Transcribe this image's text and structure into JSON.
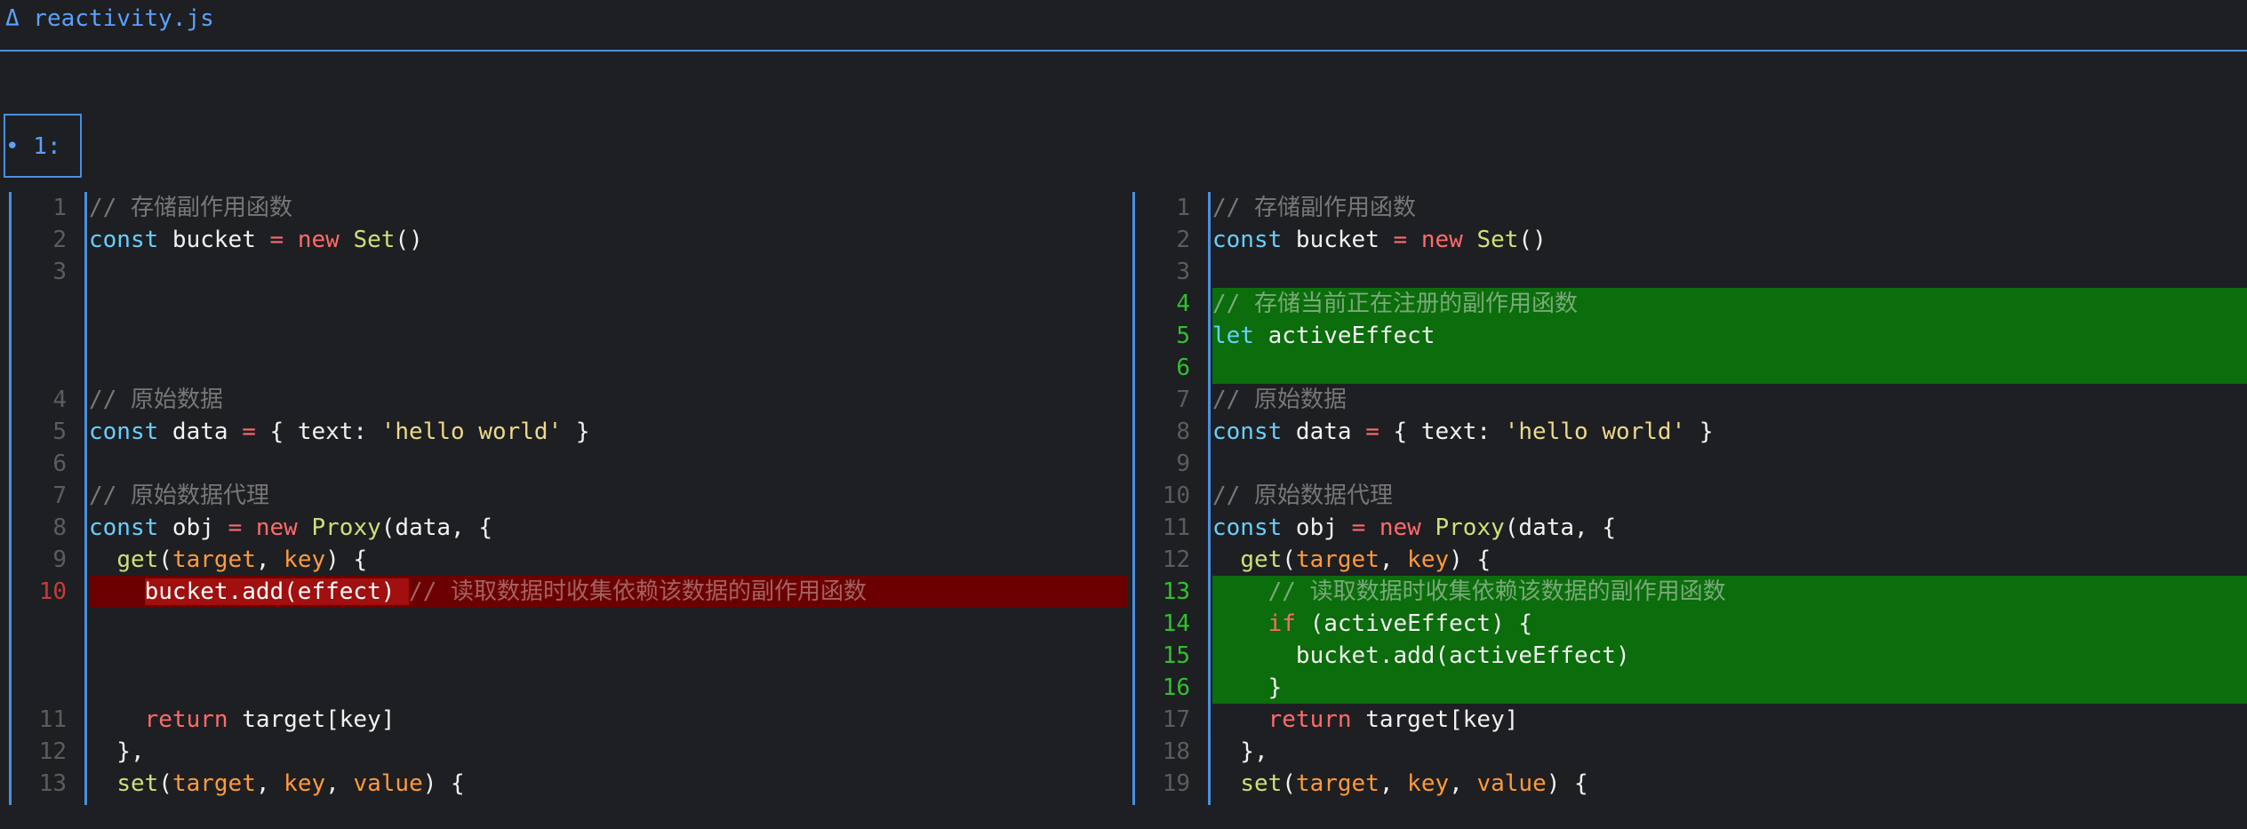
{
  "window": {
    "title": "Δ reactivity.js"
  },
  "hunk": {
    "label": "• 1:"
  },
  "colors": {
    "accent": "#4a8fe0",
    "deletion_bg": "#6b0000",
    "addition_bg": "#0b6d0b",
    "background": "#1e1f22"
  },
  "left": {
    "lines": [
      {
        "n": "1",
        "tokens": [
          {
            "t": "// 存储副作用函数",
            "c": "cm"
          }
        ]
      },
      {
        "n": "2",
        "tokens": [
          {
            "t": "const",
            "c": "kw"
          },
          {
            "t": " bucket "
          },
          {
            "t": "=",
            "c": "op"
          },
          {
            "t": " "
          },
          {
            "t": "new",
            "c": "op"
          },
          {
            "t": " "
          },
          {
            "t": "Set",
            "c": "cls"
          },
          {
            "t": "()"
          }
        ]
      },
      {
        "n": "3",
        "tokens": []
      },
      {
        "n": "",
        "tokens": []
      },
      {
        "n": "",
        "tokens": []
      },
      {
        "n": "",
        "tokens": []
      },
      {
        "n": "4",
        "tokens": [
          {
            "t": "// 原始数据",
            "c": "cm"
          }
        ]
      },
      {
        "n": "5",
        "tokens": [
          {
            "t": "const",
            "c": "kw"
          },
          {
            "t": " data "
          },
          {
            "t": "=",
            "c": "op"
          },
          {
            "t": " { text: "
          },
          {
            "t": "'hello world'",
            "c": "str"
          },
          {
            "t": " }"
          }
        ]
      },
      {
        "n": "6",
        "tokens": []
      },
      {
        "n": "7",
        "tokens": [
          {
            "t": "// 原始数据代理",
            "c": "cm"
          }
        ]
      },
      {
        "n": "8",
        "tokens": [
          {
            "t": "const",
            "c": "kw"
          },
          {
            "t": " obj "
          },
          {
            "t": "=",
            "c": "op"
          },
          {
            "t": " "
          },
          {
            "t": "new",
            "c": "op"
          },
          {
            "t": " "
          },
          {
            "t": "Proxy",
            "c": "cls"
          },
          {
            "t": "(data, {"
          }
        ]
      },
      {
        "n": "9",
        "tokens": [
          {
            "t": "  "
          },
          {
            "t": "get",
            "c": "fn"
          },
          {
            "t": "("
          },
          {
            "t": "target",
            "c": "prm"
          },
          {
            "t": ", "
          },
          {
            "t": "key",
            "c": "prm"
          },
          {
            "t": ") {"
          }
        ]
      },
      {
        "n": "10",
        "kind": "del",
        "tokens": [
          {
            "t": "    "
          },
          {
            "t": "bucket.add(effect) ",
            "c": "del-hl"
          },
          {
            "t": "// 读取数据时收集依赖该数据的副作用函数",
            "c": "cm"
          }
        ]
      },
      {
        "n": "",
        "tokens": []
      },
      {
        "n": "",
        "tokens": []
      },
      {
        "n": "",
        "tokens": []
      },
      {
        "n": "11",
        "tokens": [
          {
            "t": "    "
          },
          {
            "t": "return",
            "c": "ret"
          },
          {
            "t": " target[key]"
          }
        ]
      },
      {
        "n": "12",
        "tokens": [
          {
            "t": "  },"
          }
        ]
      },
      {
        "n": "13",
        "tokens": [
          {
            "t": "  "
          },
          {
            "t": "set",
            "c": "fn"
          },
          {
            "t": "("
          },
          {
            "t": "target",
            "c": "prm"
          },
          {
            "t": ", "
          },
          {
            "t": "key",
            "c": "prm"
          },
          {
            "t": ", "
          },
          {
            "t": "value",
            "c": "prm"
          },
          {
            "t": ") {"
          }
        ]
      }
    ]
  },
  "right": {
    "lines": [
      {
        "n": "1",
        "tokens": [
          {
            "t": "// 存储副作用函数",
            "c": "cm"
          }
        ]
      },
      {
        "n": "2",
        "tokens": [
          {
            "t": "const",
            "c": "kw"
          },
          {
            "t": " bucket "
          },
          {
            "t": "=",
            "c": "op"
          },
          {
            "t": " "
          },
          {
            "t": "new",
            "c": "op"
          },
          {
            "t": " "
          },
          {
            "t": "Set",
            "c": "cls"
          },
          {
            "t": "()"
          }
        ]
      },
      {
        "n": "3",
        "tokens": []
      },
      {
        "n": "4",
        "kind": "add",
        "tokens": [
          {
            "t": "// 存储当前正在注册的副作用函数",
            "c": "cm"
          }
        ]
      },
      {
        "n": "5",
        "kind": "add",
        "tokens": [
          {
            "t": "let",
            "c": "kw"
          },
          {
            "t": " activeEffect"
          }
        ]
      },
      {
        "n": "6",
        "kind": "add",
        "tokens": []
      },
      {
        "n": "7",
        "tokens": [
          {
            "t": "// 原始数据",
            "c": "cm"
          }
        ]
      },
      {
        "n": "8",
        "tokens": [
          {
            "t": "const",
            "c": "kw"
          },
          {
            "t": " data "
          },
          {
            "t": "=",
            "c": "op"
          },
          {
            "t": " { text: "
          },
          {
            "t": "'hello world'",
            "c": "str"
          },
          {
            "t": " }"
          }
        ]
      },
      {
        "n": "9",
        "tokens": []
      },
      {
        "n": "10",
        "tokens": [
          {
            "t": "// 原始数据代理",
            "c": "cm"
          }
        ]
      },
      {
        "n": "11",
        "tokens": [
          {
            "t": "const",
            "c": "kw"
          },
          {
            "t": " obj "
          },
          {
            "t": "=",
            "c": "op"
          },
          {
            "t": " "
          },
          {
            "t": "new",
            "c": "op"
          },
          {
            "t": " "
          },
          {
            "t": "Proxy",
            "c": "cls"
          },
          {
            "t": "(data, {"
          }
        ]
      },
      {
        "n": "12",
        "tokens": [
          {
            "t": "  "
          },
          {
            "t": "get",
            "c": "fn"
          },
          {
            "t": "("
          },
          {
            "t": "target",
            "c": "prm"
          },
          {
            "t": ", "
          },
          {
            "t": "key",
            "c": "prm"
          },
          {
            "t": ") {"
          }
        ]
      },
      {
        "n": "13",
        "kind": "add",
        "tokens": [
          {
            "t": "    "
          },
          {
            "t": "// 读取数据时收集依赖该数据的副作用函数",
            "c": "cm"
          }
        ]
      },
      {
        "n": "14",
        "kind": "add",
        "tokens": [
          {
            "t": "    "
          },
          {
            "t": "if",
            "c": "ret"
          },
          {
            "t": " (activeEffect) {"
          }
        ]
      },
      {
        "n": "15",
        "kind": "add",
        "tokens": [
          {
            "t": "      bucket.add(activeEffect)"
          }
        ]
      },
      {
        "n": "16",
        "kind": "add",
        "tokens": [
          {
            "t": "    }"
          }
        ]
      },
      {
        "n": "17",
        "tokens": [
          {
            "t": "    "
          },
          {
            "t": "return",
            "c": "ret"
          },
          {
            "t": " target[key]"
          }
        ]
      },
      {
        "n": "18",
        "tokens": [
          {
            "t": "  },"
          }
        ]
      },
      {
        "n": "19",
        "tokens": [
          {
            "t": "  "
          },
          {
            "t": "set",
            "c": "fn"
          },
          {
            "t": "("
          },
          {
            "t": "target",
            "c": "prm"
          },
          {
            "t": ", "
          },
          {
            "t": "key",
            "c": "prm"
          },
          {
            "t": ", "
          },
          {
            "t": "value",
            "c": "prm"
          },
          {
            "t": ") {"
          }
        ]
      }
    ]
  }
}
